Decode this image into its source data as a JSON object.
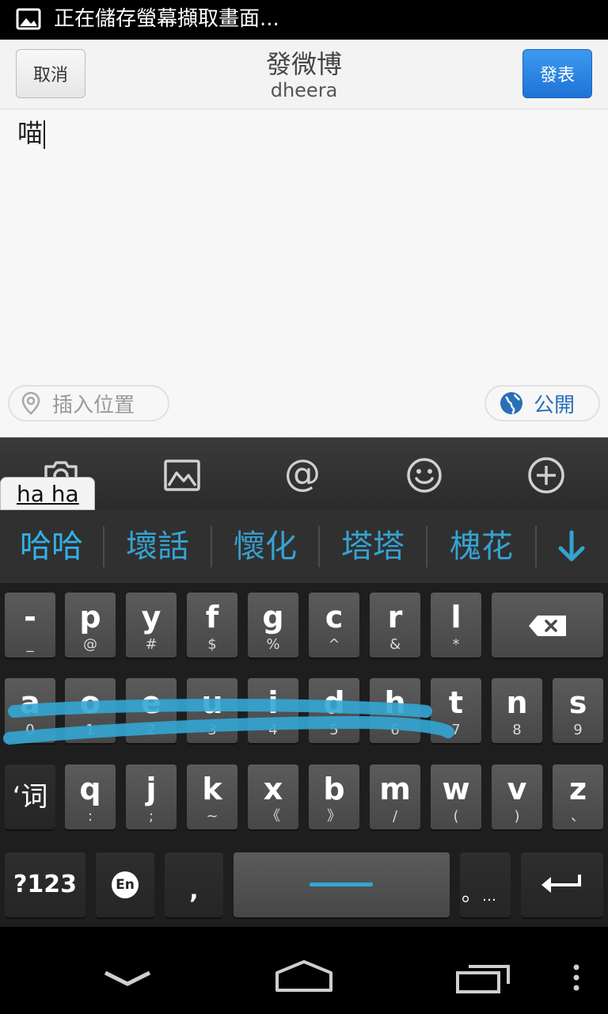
{
  "status_bar": {
    "notification_text": "正在儲存螢幕擷取畫面...",
    "icon": "image-icon"
  },
  "header": {
    "cancel_label": "取消",
    "title": "發微博",
    "subtitle": "dheera",
    "post_label": "發表"
  },
  "compose": {
    "text": "喵",
    "location_label": "插入位置",
    "visibility_label": "公開"
  },
  "toolbar": {
    "icons": [
      "camera-icon",
      "image-icon",
      "at-icon",
      "smiley-icon",
      "plus-icon"
    ],
    "hint_text": "ha ha"
  },
  "candidates": {
    "items": [
      "哈哈",
      "壞話",
      "懷化",
      "塔塔",
      "槐花"
    ],
    "expand_icon": "arrow-down-icon"
  },
  "keyboard": {
    "row1": [
      {
        "main": "-",
        "sub": "_"
      },
      {
        "main": "p",
        "sub": "@"
      },
      {
        "main": "y",
        "sub": "#"
      },
      {
        "main": "f",
        "sub": "$"
      },
      {
        "main": "g",
        "sub": "%"
      },
      {
        "main": "c",
        "sub": "^"
      },
      {
        "main": "r",
        "sub": "&"
      },
      {
        "main": "l",
        "sub": "*"
      }
    ],
    "row2": [
      {
        "main": "a",
        "sub": "0"
      },
      {
        "main": "o",
        "sub": "1"
      },
      {
        "main": "e",
        "sub": "2"
      },
      {
        "main": "u",
        "sub": "3"
      },
      {
        "main": "i",
        "sub": "4"
      },
      {
        "main": "d",
        "sub": "5"
      },
      {
        "main": "h",
        "sub": "6"
      },
      {
        "main": "t",
        "sub": "7"
      },
      {
        "main": "n",
        "sub": "8"
      },
      {
        "main": "s",
        "sub": "9"
      }
    ],
    "row3": [
      {
        "main": "q",
        "sub": ":"
      },
      {
        "main": "j",
        "sub": ";"
      },
      {
        "main": "k",
        "sub": "~"
      },
      {
        "main": "x",
        "sub": "《"
      },
      {
        "main": "b",
        "sub": "》"
      },
      {
        "main": "m",
        "sub": "/"
      },
      {
        "main": "w",
        "sub": "("
      },
      {
        "main": "v",
        "sub": ")"
      },
      {
        "main": "z",
        "sub": "、"
      }
    ],
    "mode_key": "‘词",
    "symbols_key": "?123",
    "lang_key": "En",
    "comma_key": ",",
    "period_key": "。",
    "period_sub": "…",
    "swipe_color": "#33a6d4"
  },
  "nav": {
    "icons": [
      "back-icon",
      "home-icon",
      "recents-icon",
      "menu-icon"
    ]
  }
}
